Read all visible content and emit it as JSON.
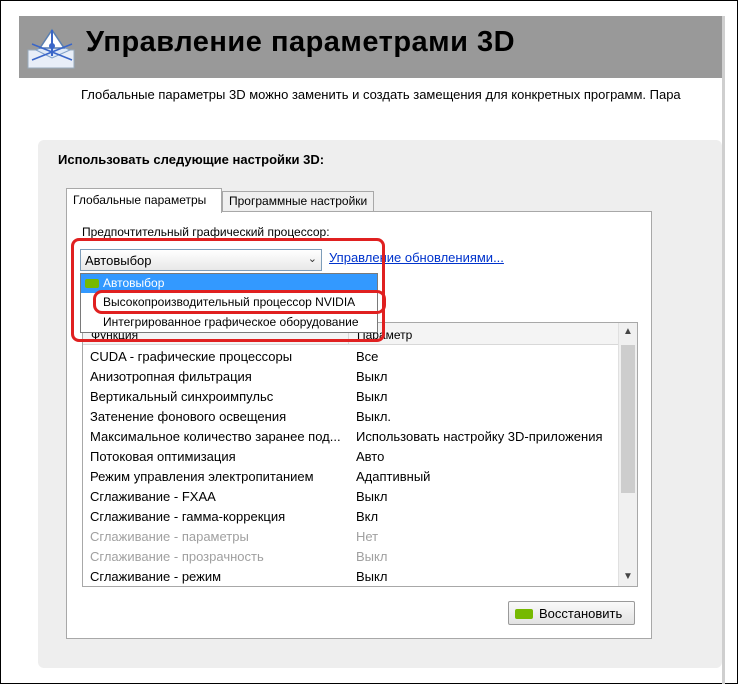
{
  "header": {
    "title": "Управление параметрами 3D"
  },
  "description": "Глобальные параметры 3D можно заменить и создать замещения для конкретных программ. Пара",
  "panel": {
    "title": "Использовать следующие настройки 3D:"
  },
  "tabs": [
    {
      "label": "Глобальные параметры"
    },
    {
      "label": "Программные настройки"
    }
  ],
  "preferred_gpu": {
    "label": "Предпочтительный графический процессор:",
    "selected": "Автовыбор",
    "manage_link": "Управление обновлениями...",
    "options": [
      {
        "label": "Автовыбор"
      },
      {
        "label": "Высокопроизводительный процессор NVIDIA"
      },
      {
        "label": "Интегрированное графическое оборудование"
      }
    ]
  },
  "table": {
    "headers": [
      "Функция",
      "Параметр"
    ],
    "rows": [
      {
        "name": "CUDA - графические процессоры",
        "value": "Все"
      },
      {
        "name": "Анизотропная фильтрация",
        "value": "Выкл"
      },
      {
        "name": "Вертикальный синхроимпульс",
        "value": "Выкл"
      },
      {
        "name": "Затенение фонового освещения",
        "value": "Выкл."
      },
      {
        "name": "Максимальное количество заранее под...",
        "value": "Использовать настройку 3D-приложения"
      },
      {
        "name": "Потоковая оптимизация",
        "value": "Авто"
      },
      {
        "name": "Режим управления электропитанием",
        "value": "Адаптивный"
      },
      {
        "name": "Сглаживание - FXAA",
        "value": "Выкл"
      },
      {
        "name": "Сглаживание - гамма-коррекция",
        "value": "Вкл"
      },
      {
        "name": "Сглаживание - параметры",
        "value": "Нет"
      },
      {
        "name": "Сглаживание - прозрачность",
        "value": "Выкл"
      },
      {
        "name": "Сглаживание - режим",
        "value": "Выкл"
      }
    ]
  },
  "restore_button": {
    "label": "Восстановить"
  },
  "colors": {
    "nvidia_green": "#76b900",
    "highlight": "#e02020",
    "selection": "#3399ff"
  }
}
